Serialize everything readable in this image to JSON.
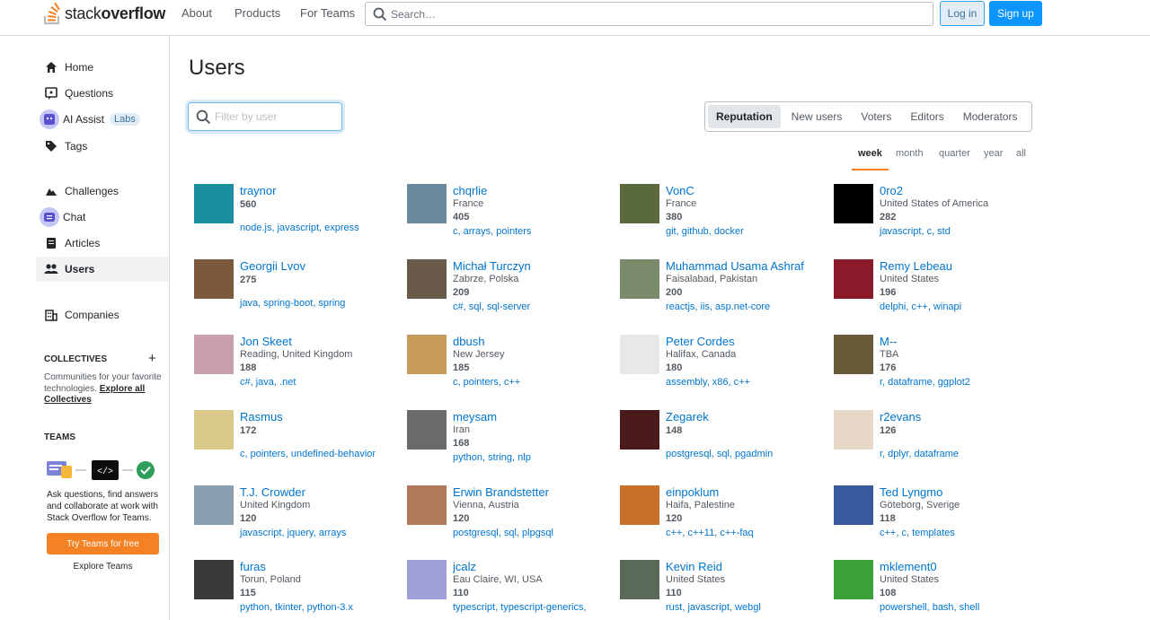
{
  "header": {
    "logo_pre": "stack",
    "logo_bold": "overflow",
    "nav": [
      "About",
      "Products",
      "For Teams"
    ],
    "search_placeholder": "Search…",
    "login": "Log in",
    "signup": "Sign up"
  },
  "sidebar": {
    "items": [
      {
        "label": "Home",
        "icon": "home-icon"
      },
      {
        "label": "Questions",
        "icon": "questions-icon"
      },
      {
        "label": "AI Assist",
        "icon": "ai-assist-icon",
        "badge": "Labs"
      },
      {
        "label": "Tags",
        "icon": "tag-icon"
      },
      {
        "label": "Challenges",
        "icon": "challenges-icon"
      },
      {
        "label": "Chat",
        "icon": "chat-icon"
      },
      {
        "label": "Articles",
        "icon": "articles-icon"
      },
      {
        "label": "Users",
        "icon": "users-icon",
        "active": true
      },
      {
        "label": "Companies",
        "icon": "companies-icon"
      }
    ],
    "collectives": {
      "title": "COLLECTIVES",
      "text": "Communities for your favorite technologies.",
      "link": "Explore all Collectives"
    },
    "teams": {
      "title": "TEAMS",
      "text": "Ask questions, find answers and collaborate at work with Stack Overflow for Teams.",
      "button": "Try Teams for free",
      "link": "Explore Teams"
    }
  },
  "main": {
    "title": "Users",
    "filter_placeholder": "Filter by user",
    "tabs": [
      "Reputation",
      "New users",
      "Voters",
      "Editors",
      "Moderators"
    ],
    "periods": [
      "week",
      "month",
      "quarter",
      "year",
      "all"
    ],
    "users": [
      {
        "name": "traynor",
        "location": "",
        "rep": "560",
        "tags": "node.js, javascript, express",
        "color": "#1b8fa0"
      },
      {
        "name": "chqrlie",
        "location": "France",
        "rep": "405",
        "tags": "c, arrays, pointers",
        "color": "#6a8aa0"
      },
      {
        "name": "VonC",
        "location": "France",
        "rep": "380",
        "tags": "git, github, docker",
        "color": "#5a6a3a"
      },
      {
        "name": "0ro2",
        "location": "United States of America",
        "rep": "282",
        "tags": "javascript, c, std",
        "color": "#000000"
      },
      {
        "name": "Georgii Lvov",
        "location": "",
        "rep": "275",
        "tags": "java, spring-boot, spring",
        "color": "#7a5a3a"
      },
      {
        "name": "Michał Turczyn",
        "location": "Zabrze, Polska",
        "rep": "209",
        "tags": "c#, sql, sql-server",
        "color": "#6a5a4a"
      },
      {
        "name": "Muhammad Usama Ashraf",
        "location": "Faisalabad, Pakistan",
        "rep": "200",
        "tags": "reactjs, iis, asp.net-core",
        "color": "#7a8a6a"
      },
      {
        "name": "Remy Lebeau",
        "location": "United States",
        "rep": "196",
        "tags": "delphi, c++, winapi",
        "color": "#8a1a2a"
      },
      {
        "name": "Jon Skeet",
        "location": "Reading, United Kingdom",
        "rep": "188",
        "tags": "c#, java, .net",
        "color": "#c8a0b0"
      },
      {
        "name": "dbush",
        "location": "New Jersey",
        "rep": "185",
        "tags": "c, pointers, c++",
        "color": "#c89a5a"
      },
      {
        "name": "Peter Cordes",
        "location": "Halifax, Canada",
        "rep": "180",
        "tags": "assembly, x86, c++",
        "color": "#e8e8e8"
      },
      {
        "name": "M--",
        "location": "TBA",
        "rep": "176",
        "tags": "r, dataframe, ggplot2",
        "color": "#6a5a3a"
      },
      {
        "name": "Rasmus",
        "location": "",
        "rep": "172",
        "tags": "c, pointers, undefined-behavior",
        "color": "#d8c88a"
      },
      {
        "name": "meysam",
        "location": "Iran",
        "rep": "168",
        "tags": "python, string, nlp",
        "color": "#6a6a6a"
      },
      {
        "name": "Zegarek",
        "location": "",
        "rep": "148",
        "tags": "postgresql, sql, pgadmin",
        "color": "#4a1a1a"
      },
      {
        "name": "r2evans",
        "location": "",
        "rep": "126",
        "tags": "r, dplyr, dataframe",
        "color": "#e8d8c8"
      },
      {
        "name": "T.J. Crowder",
        "location": "United Kingdom",
        "rep": "120",
        "tags": "javascript, jquery, arrays",
        "color": "#8aa0b0"
      },
      {
        "name": "Erwin Brandstetter",
        "location": "Vienna, Austria",
        "rep": "120",
        "tags": "postgresql, sql, plpgsql",
        "color": "#b07a5a"
      },
      {
        "name": "einpoklum",
        "location": "Haifa, Palestine",
        "rep": "120",
        "tags": "c++, c++11, c++-faq",
        "color": "#c8702a"
      },
      {
        "name": "Ted Lyngmo",
        "location": "Göteborg, Sverige",
        "rep": "118",
        "tags": "c++, c, templates",
        "color": "#3a5aa0"
      },
      {
        "name": "furas",
        "location": "Torun, Poland",
        "rep": "115",
        "tags": "python, tkinter, python-3.x",
        "color": "#3a3a3a"
      },
      {
        "name": "jcalz",
        "location": "Eau Claire, WI, USA",
        "rep": "110",
        "tags": "typescript, typescript-generics,",
        "color": "#a0a0d8"
      },
      {
        "name": "Kevin Reid",
        "location": "United States",
        "rep": "110",
        "tags": "rust, javascript, webgl",
        "color": "#5a6a5a"
      },
      {
        "name": "mklement0",
        "location": "United States",
        "rep": "108",
        "tags": "powershell, bash, shell",
        "color": "#3aa03a"
      }
    ]
  }
}
